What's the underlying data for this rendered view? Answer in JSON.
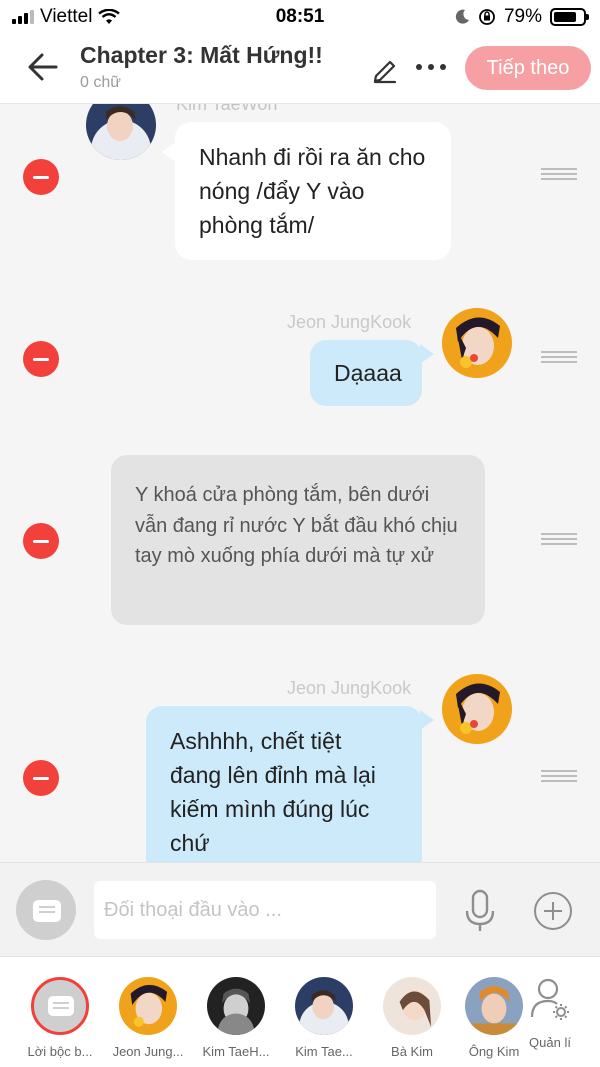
{
  "status_bar": {
    "carrier": "Viettel",
    "time": "08:51",
    "battery": "79%",
    "battery_level": 0.79
  },
  "header": {
    "title": "Chapter 3: Mất Hứng!!",
    "subtitle": "0 chữ",
    "next_label": "Tiếp theo"
  },
  "messages": [
    {
      "kind": "left",
      "speaker": "Kim TaeWon",
      "text": "Nhanh đi rồi ra ăn cho nóng /đẩy Y vào phòng tắm/"
    },
    {
      "kind": "right",
      "speaker": "Jeon JungKook",
      "text": "Dạaaa"
    },
    {
      "kind": "narration",
      "text": "Y khoá cửa phòng tắm, bên dưới vẫn đang rỉ nước Y bắt đầu khó chịu tay mò xuống phía dưới mà tự xử"
    },
    {
      "kind": "right",
      "speaker": "Jeon JungKook",
      "text": "Ashhhh, chết tiệt đang lên đỉnh mà lại kiếm mình đúng lúc chứ"
    }
  ],
  "input": {
    "placeholder": "Đối thoại đầu vào ..."
  },
  "characters": [
    {
      "label": "Lời bộc b..."
    },
    {
      "label": "Jeon Jung..."
    },
    {
      "label": "Kim TaeH..."
    },
    {
      "label": "Kim Tae..."
    },
    {
      "label": "Bà Kim"
    },
    {
      "label": "Ông Kim"
    }
  ],
  "manage_label": "Quản lí",
  "colors": {
    "accent": "#f6a0a4",
    "remove": "#f2403a",
    "right_bubble": "#cdeafb",
    "narration_bubble": "#e3e3e3"
  }
}
